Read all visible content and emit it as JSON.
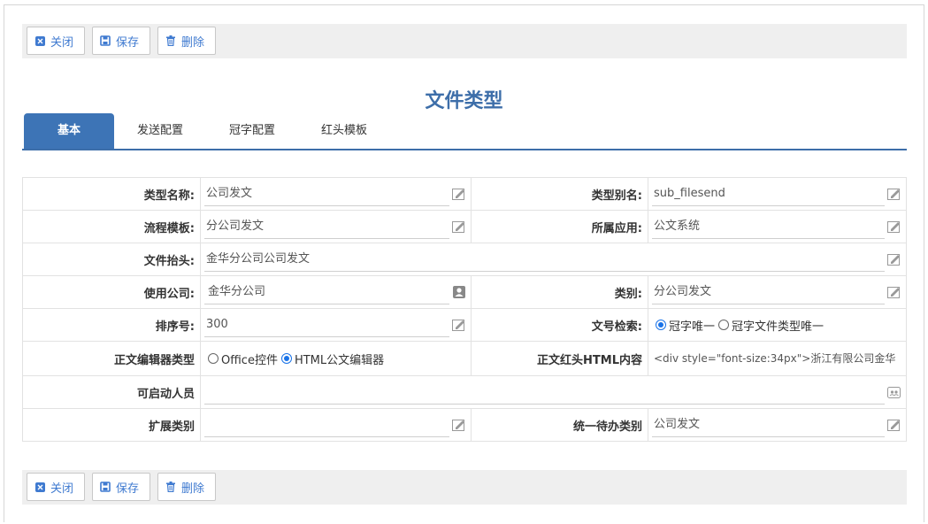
{
  "toolbar": {
    "close_label": "关闭",
    "save_label": "保存",
    "delete_label": "删除"
  },
  "page": {
    "title": "文件类型"
  },
  "tabs": [
    {
      "label": "基本",
      "active": true
    },
    {
      "label": "发送配置"
    },
    {
      "label": "冠字配置"
    },
    {
      "label": "红头模板"
    }
  ],
  "form": {
    "type_name": {
      "label": "类型名称:",
      "value": "公司发文"
    },
    "type_alias": {
      "label": "类型别名:",
      "value": "sub_filesend"
    },
    "flow_template": {
      "label": "流程模板:",
      "value": "分公司发文"
    },
    "app": {
      "label": "所属应用:",
      "value": "公文系统"
    },
    "header": {
      "label": "文件抬头:",
      "value": "金华分公司公司发文"
    },
    "company": {
      "label": "使用公司:",
      "value": "金华分公司"
    },
    "category": {
      "label": "类别:",
      "value": "分公司发文"
    },
    "sort_no": {
      "label": "排序号:",
      "value": "300"
    },
    "doc_search": {
      "label": "文号检索:",
      "options": [
        "冠字唯一",
        "冠字文件类型唯一"
      ],
      "selected": "冠字唯一"
    },
    "editor_type": {
      "label": "正文编辑器类型",
      "options": [
        "Office控件",
        "HTML公文编辑器"
      ],
      "selected": "HTML公文编辑器"
    },
    "red_html": {
      "label": "正文红头HTML内容",
      "value": "<div style=\"font-size:34px\">浙江有限公司金华"
    },
    "starters": {
      "label": "可启动人员",
      "value": ""
    },
    "ext_category": {
      "label": "扩展类别",
      "value": ""
    },
    "todo_category": {
      "label": "统一待办类别",
      "value": "公司发文"
    }
  },
  "colors": {
    "accent": "#3d74b6",
    "title": "#3d6ea9",
    "button_text": "#3f7ad0"
  }
}
